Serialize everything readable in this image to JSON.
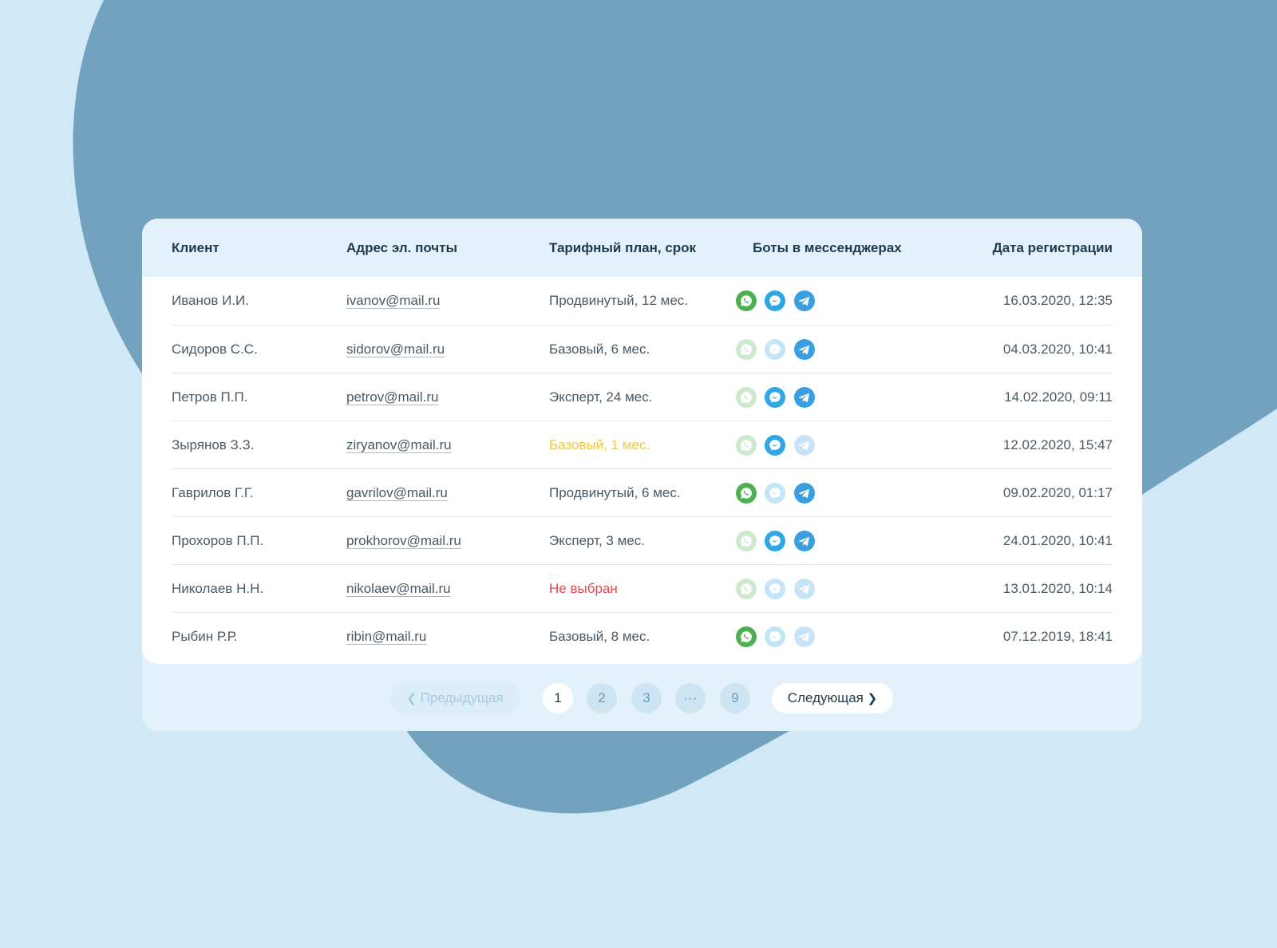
{
  "colors": {
    "page_bg": "#d1e8f6",
    "blob": "#72a2be",
    "text": "#4a5963",
    "heading": "#1f3a4d",
    "warning": "#f3c545",
    "error": "#e8454d",
    "whatsapp": "#4caf50",
    "messenger": "#2ea6e8",
    "telegram": "#3a9fe0"
  },
  "table": {
    "headers": {
      "client": "Клиент",
      "email": "Адрес эл. почты",
      "plan": "Тарифный план, срок",
      "bots": "Боты в мессенджерах",
      "date": "Дата регистрации"
    },
    "rows": [
      {
        "client": "Иванов И.И.",
        "email": "ivanov@mail.ru",
        "plan": "Продвинутый, 12 мес.",
        "plan_status": "normal",
        "bots": {
          "whatsapp": true,
          "messenger": true,
          "telegram": true
        },
        "date": "16.03.2020, 12:35"
      },
      {
        "client": "Сидоров С.С.",
        "email": "sidorov@mail.ru",
        "plan": "Базовый, 6 мес.",
        "plan_status": "normal",
        "bots": {
          "whatsapp": false,
          "messenger": false,
          "telegram": true
        },
        "date": "04.03.2020, 10:41"
      },
      {
        "client": "Петров П.П.",
        "email": "petrov@mail.ru",
        "plan": "Эксперт, 24 мес.",
        "plan_status": "normal",
        "bots": {
          "whatsapp": false,
          "messenger": true,
          "telegram": true
        },
        "date": "14.02.2020, 09:11"
      },
      {
        "client": "Зырянов З.З.",
        "email": "ziryanov@mail.ru",
        "plan": "Базовый, 1 мес.",
        "plan_status": "warning",
        "bots": {
          "whatsapp": false,
          "messenger": true,
          "telegram": false
        },
        "date": "12.02.2020, 15:47"
      },
      {
        "client": "Гаврилов Г.Г.",
        "email": "gavrilov@mail.ru",
        "plan": "Продвинутый, 6 мес.",
        "plan_status": "normal",
        "bots": {
          "whatsapp": true,
          "messenger": false,
          "telegram": true
        },
        "date": "09.02.2020, 01:17"
      },
      {
        "client": "Прохоров П.П.",
        "email": "prokhorov@mail.ru",
        "plan": "Эксперт, 3 мес.",
        "plan_status": "normal",
        "bots": {
          "whatsapp": false,
          "messenger": true,
          "telegram": true
        },
        "date": "24.01.2020, 10:41"
      },
      {
        "client": "Николаев Н.Н.",
        "email": "nikolaev@mail.ru",
        "plan": "Не выбран",
        "plan_status": "error",
        "bots": {
          "whatsapp": false,
          "messenger": false,
          "telegram": false
        },
        "date": "13.01.2020, 10:14"
      },
      {
        "client": "Рыбин Р.Р.",
        "email": "ribin@mail.ru",
        "plan": "Базовый, 8 мес.",
        "plan_status": "normal",
        "bots": {
          "whatsapp": true,
          "messenger": false,
          "telegram": false
        },
        "date": "07.12.2019, 18:41"
      }
    ]
  },
  "pagination": {
    "prev_label": "Предыдущая",
    "prev_icon": "chevron-left-icon",
    "pages": [
      "1",
      "2",
      "3",
      "···",
      "9"
    ],
    "current_page": "1",
    "next_label": "Следующая",
    "next_icon": "chevron-right-icon"
  }
}
